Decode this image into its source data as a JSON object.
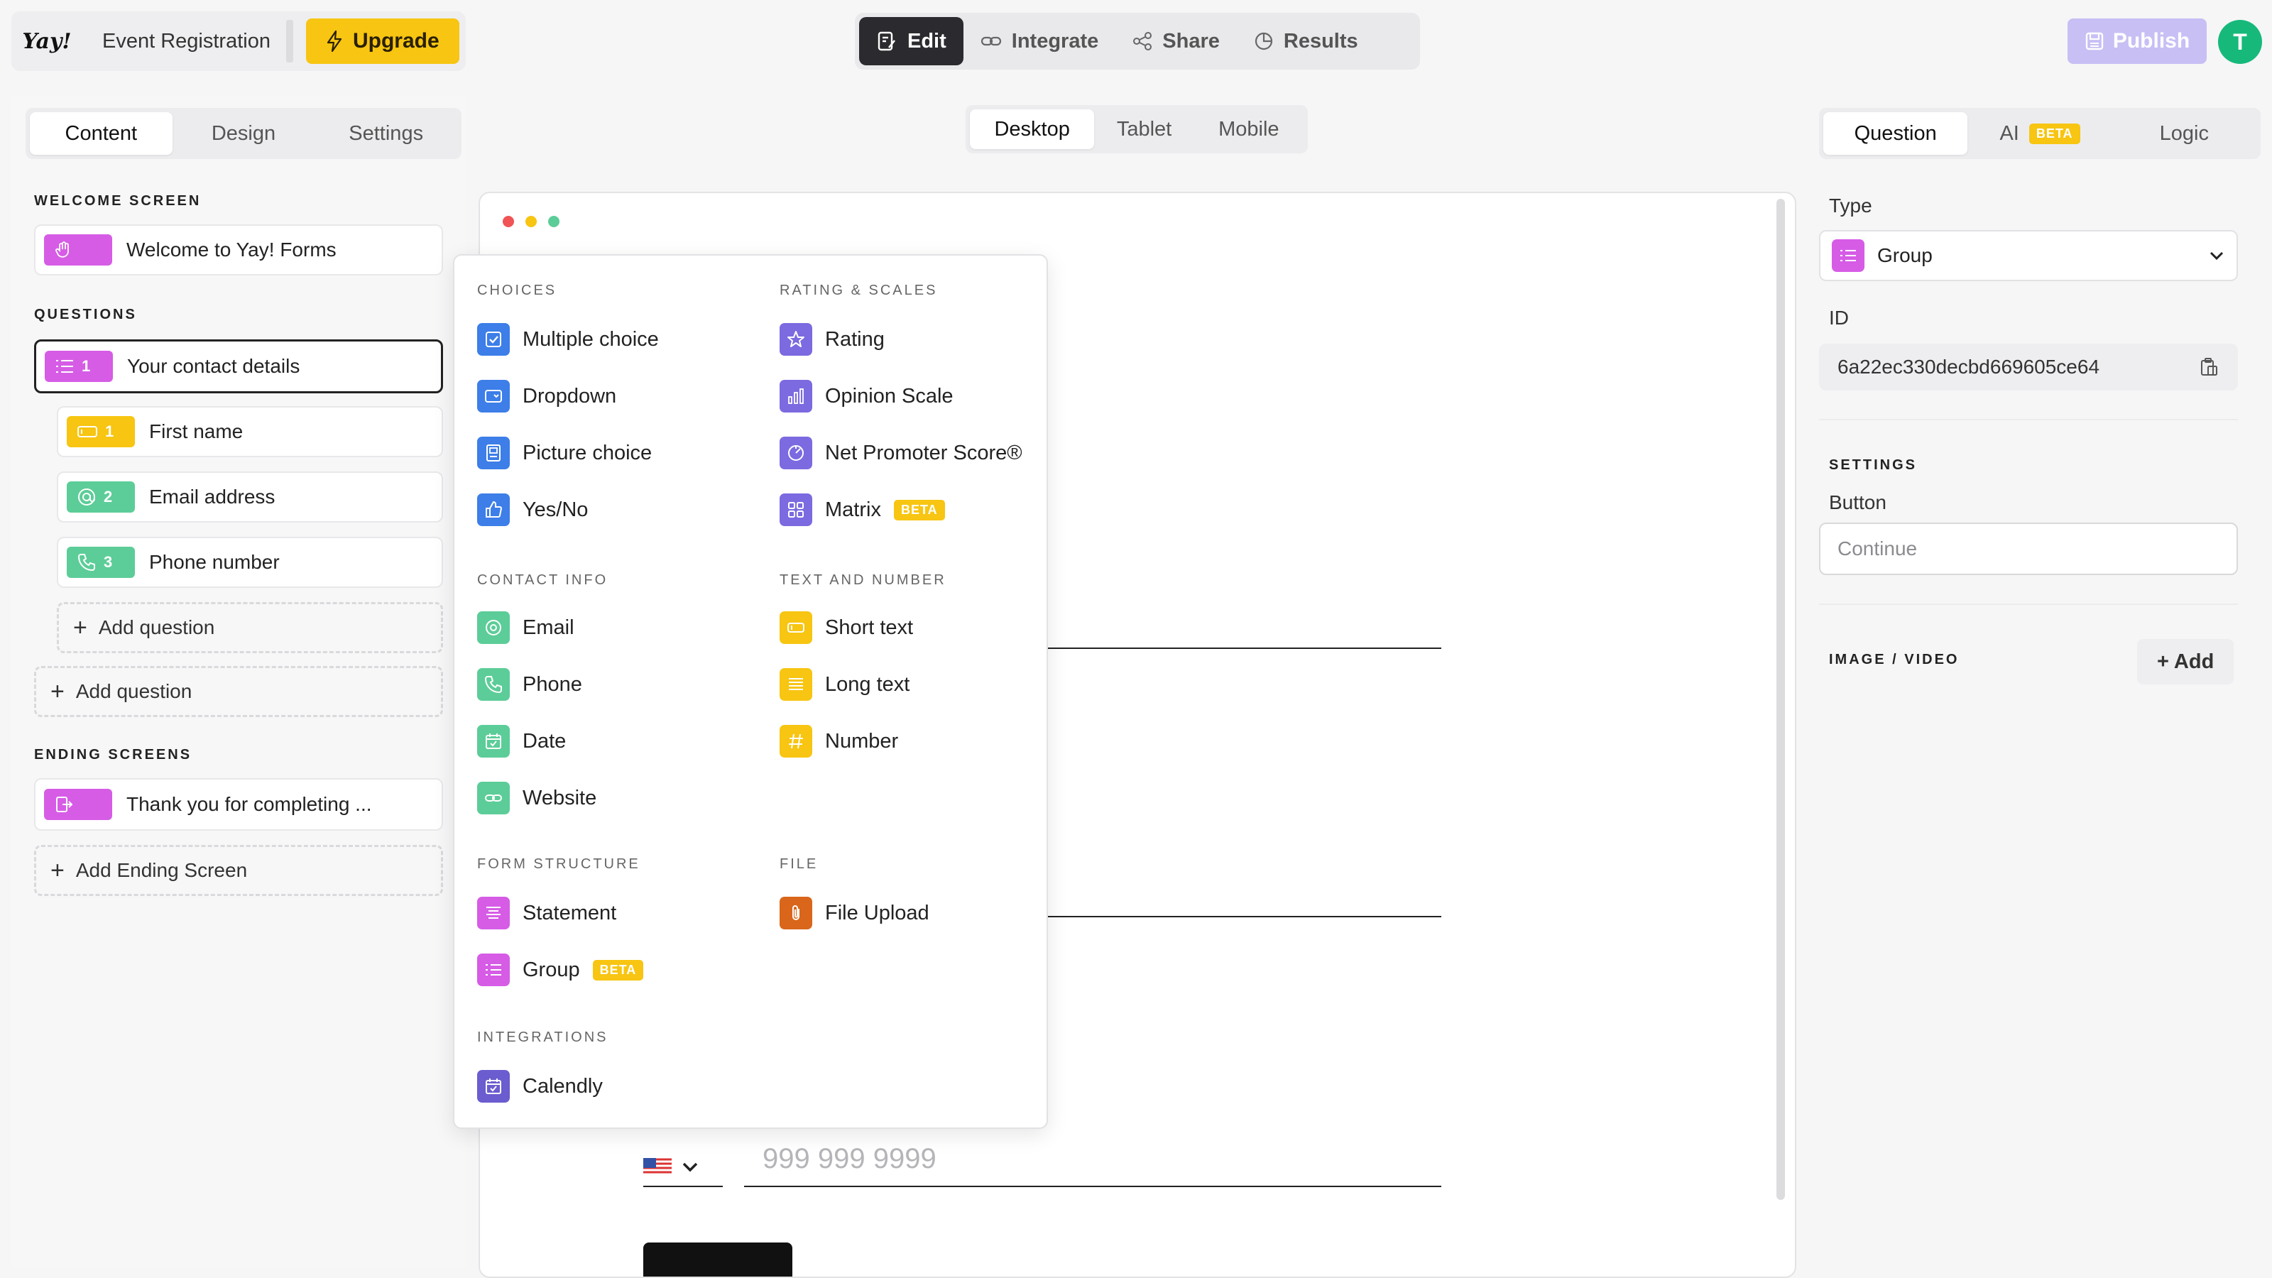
{
  "header": {
    "logo_text": "Yay!",
    "form_title": "Event Registration",
    "upgrade_label": "Upgrade",
    "tabs": [
      {
        "label": "Edit"
      },
      {
        "label": "Integrate"
      },
      {
        "label": "Share"
      },
      {
        "label": "Results"
      }
    ],
    "publish_label": "Publish",
    "avatar_initial": "T"
  },
  "left_panel": {
    "tabs": [
      {
        "label": "Content"
      },
      {
        "label": "Design"
      },
      {
        "label": "Settings"
      }
    ],
    "welcome_label": "WELCOME SCREEN",
    "welcome_item": "Welcome to Yay! Forms",
    "questions_label": "QUESTIONS",
    "questions": [
      {
        "number": "1",
        "label": "Your contact details",
        "color": "#d65ce6"
      },
      {
        "number": "1",
        "label": "First name",
        "color": "#f7c512"
      },
      {
        "number": "2",
        "label": "Email address",
        "color": "#5ccd98"
      },
      {
        "number": "3",
        "label": "Phone number",
        "color": "#5ccd98"
      }
    ],
    "add_question_inner": "Add question",
    "add_question_outer": "Add question",
    "ending_label": "ENDING SCREENS",
    "ending_item": "Thank you for completing ...",
    "add_ending": "Add Ending Screen"
  },
  "preview": {
    "device_tabs": [
      {
        "label": "Desktop"
      },
      {
        "label": "Tablet"
      },
      {
        "label": "Mobile"
      }
    ],
    "phone_placeholder": "999 999 9999"
  },
  "menu": {
    "groups": {
      "choices": "CHOICES",
      "rating": "RATING & SCALES",
      "contact": "CONTACT INFO",
      "text": "TEXT AND NUMBER",
      "structure": "FORM STRUCTURE",
      "file": "FILE",
      "integrations": "INTEGRATIONS"
    },
    "items": {
      "multiple_choice": "Multiple choice",
      "dropdown": "Dropdown",
      "picture_choice": "Picture choice",
      "yes_no": "Yes/No",
      "rating": "Rating",
      "opinion_scale": "Opinion Scale",
      "nps": "Net Promoter Score®",
      "matrix": "Matrix",
      "email": "Email",
      "phone": "Phone",
      "date": "Date",
      "website": "Website",
      "short_text": "Short text",
      "long_text": "Long text",
      "number": "Number",
      "statement": "Statement",
      "group": "Group",
      "file_upload": "File Upload",
      "calendly": "Calendly"
    },
    "beta_label": "BETA"
  },
  "right_panel": {
    "tabs": [
      {
        "label": "Question"
      },
      {
        "label": "AI"
      },
      {
        "label": "Logic"
      }
    ],
    "ai_beta": "BETA",
    "type_label": "Type",
    "type_value": "Group",
    "id_label": "ID",
    "id_value": "6a22ec330decbd669605ce64",
    "settings_label": "SETTINGS",
    "button_label": "Button",
    "button_placeholder": "Continue",
    "media_label": "IMAGE / VIDEO",
    "add_label": "+ Add"
  },
  "colors": {
    "accent_yellow": "#f7c512",
    "group_pink": "#d65ce6",
    "contact_green": "#5ccd98",
    "choice_blue": "#3d7ee8",
    "rating_purple": "#7b6ae0",
    "file_orange": "#d9661a",
    "publish_lilac": "#c8bff5",
    "avatar_green": "#16b97a"
  }
}
